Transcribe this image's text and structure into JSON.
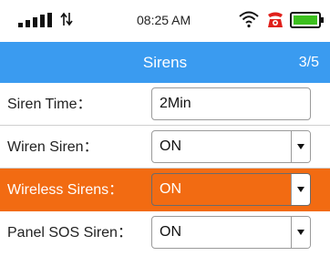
{
  "status_bar": {
    "time": "08:25 AM",
    "icons": [
      "signal-icon",
      "sync-arrows-icon",
      "wifi-icon",
      "alarm-icon",
      "battery-icon"
    ]
  },
  "header": {
    "title": "Sirens",
    "page_indicator": "3/5"
  },
  "settings": [
    {
      "label": "Siren Time：",
      "value": "2Min",
      "control": "text-input"
    },
    {
      "label": "Wiren Siren：",
      "value": "ON",
      "control": "dropdown"
    },
    {
      "label": "Wireless Sirens：",
      "value": "ON",
      "control": "dropdown",
      "selected": true
    },
    {
      "label": "Panel SOS Siren：",
      "value": "ON",
      "control": "dropdown"
    }
  ],
  "colors": {
    "title_bar": "#3a9bf0",
    "selected_row": "#f26b12",
    "alarm_icon": "#e0201b"
  }
}
